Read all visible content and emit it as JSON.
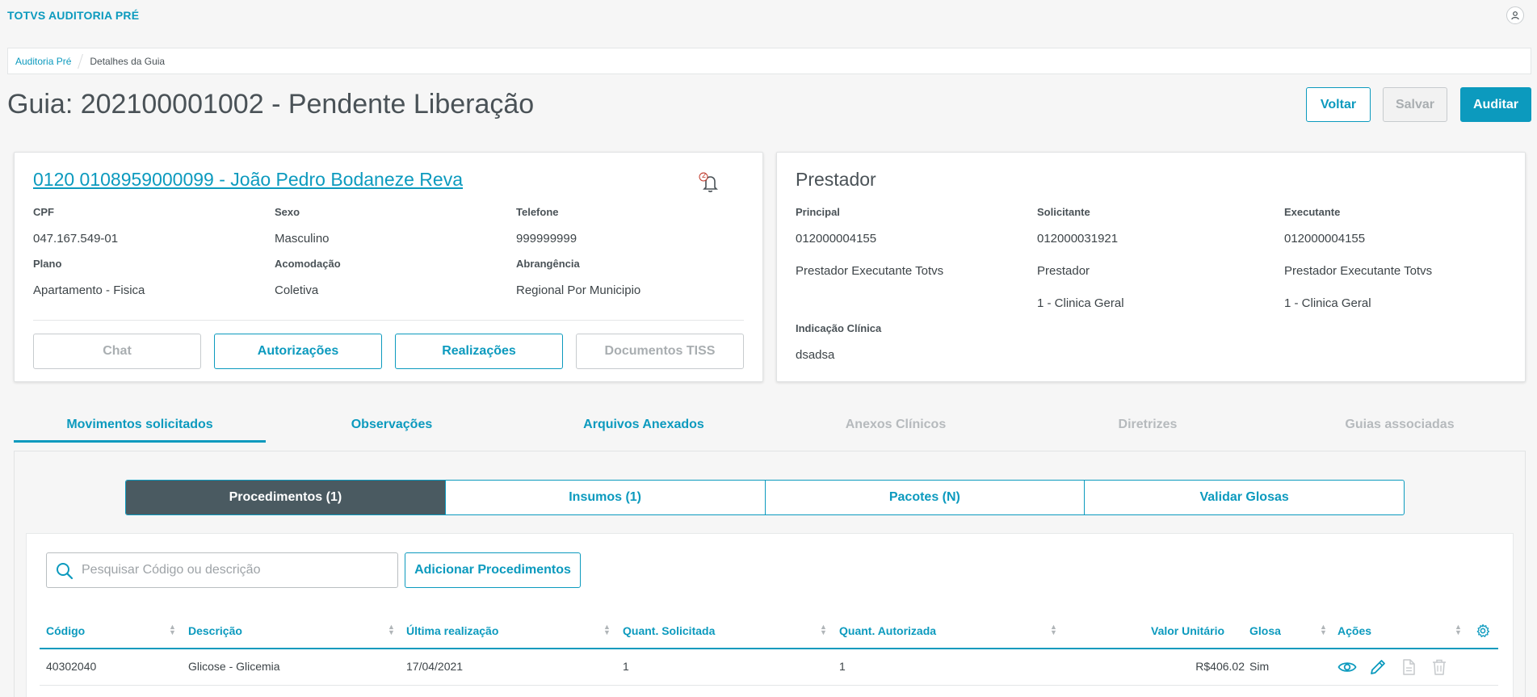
{
  "app": {
    "title": "TOTVS AUDITORIA PRÉ"
  },
  "breadcrumb": {
    "items": [
      "Auditoria Pré",
      "Detalhes da Guia"
    ]
  },
  "page": {
    "title": "Guia: 202100001002 - Pendente Liberação"
  },
  "actions": {
    "voltar": "Voltar",
    "salvar": "Salvar",
    "auditar": "Auditar"
  },
  "beneficiario": {
    "name": "0120 0108959000099 - João Pedro Bodaneze Reva",
    "notifications": "2",
    "fields": {
      "cpf_label": "CPF",
      "cpf": "047.167.549-01",
      "sexo_label": "Sexo",
      "sexo": "Masculino",
      "telefone_label": "Telefone",
      "telefone": "999999999",
      "plano_label": "Plano",
      "plano": "Apartamento - Fisica",
      "acomodacao_label": "Acomodação",
      "acomodacao": "Coletiva",
      "abrangencia_label": "Abrangência",
      "abrangencia": "Regional Por Municipio"
    },
    "buttons": {
      "chat": "Chat",
      "autorizacoes": "Autorizações",
      "realizacoes": "Realizações",
      "documentos": "Documentos TISS"
    }
  },
  "prestador": {
    "title": "Prestador",
    "principal_label": "Principal",
    "principal_code": "012000004155",
    "principal_name": "Prestador Executante Totvs",
    "solicitante_label": "Solicitante",
    "solicitante_code": "012000031921",
    "solicitante_name": "Prestador",
    "solicitante_spec": "1 - Clinica Geral",
    "executante_label": "Executante",
    "executante_code": "012000004155",
    "executante_name": "Prestador Executante Totvs",
    "executante_spec": "1 - Clinica Geral",
    "indicacao_label": "Indicação Clínica",
    "indicacao": "dsadsa"
  },
  "tabs": [
    "Movimentos solicitados",
    "Observações",
    "Arquivos Anexados",
    "Anexos Clínicos",
    "Diretrizes",
    "Guias associadas"
  ],
  "segments": [
    "Procedimentos (1)",
    "Insumos (1)",
    "Pacotes (N)",
    "Validar Glosas"
  ],
  "search": {
    "placeholder": "Pesquisar Código ou descrição",
    "value": ""
  },
  "add_button": "Adicionar Procedimentos",
  "table": {
    "headers": [
      "Código",
      "Descrição",
      "Última realização",
      "Quant. Solicitada",
      "Quant. Autorizada",
      "Valor Unitário",
      "Glosa",
      "Ações"
    ],
    "rows": [
      {
        "codigo": "40302040",
        "descricao": "Glicose - Glicemia",
        "ultima": "17/04/2021",
        "qsol": "1",
        "qaut": "1",
        "valor": "R$406.02",
        "glosa": "Sim"
      }
    ]
  },
  "icons": [
    "user-icon",
    "bell-icon",
    "search-icon",
    "gear-icon",
    "eye-icon",
    "pencil-icon",
    "document-icon",
    "trash-icon"
  ],
  "colors": {
    "accent": "#0c9abe",
    "segment_active": "#4a5a61",
    "background": "#f6f6f6"
  }
}
